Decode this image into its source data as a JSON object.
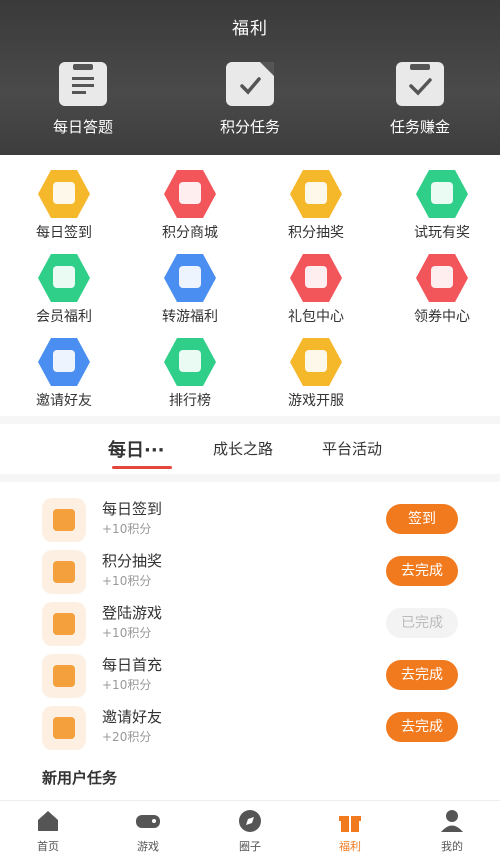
{
  "header": {
    "title": "福利",
    "features": [
      {
        "label": "每日答题",
        "icon": "quiz-clipboard-icon"
      },
      {
        "label": "积分任务",
        "icon": "points-task-icon"
      },
      {
        "label": "任务赚金",
        "icon": "earn-task-icon"
      }
    ]
  },
  "grid": [
    {
      "label": "每日签到",
      "icon": "calendar-check-icon",
      "color": "#f6b82b"
    },
    {
      "label": "积分商城",
      "icon": "shop-icon",
      "color": "#f2555a"
    },
    {
      "label": "积分抽奖",
      "icon": "coin-stack-icon",
      "color": "#f6b82b"
    },
    {
      "label": "试玩有奖",
      "icon": "trial-reward-icon",
      "color": "#2fcf8a"
    },
    {
      "label": "会员福利",
      "icon": "vip-badge-icon",
      "color": "#2fcf8a"
    },
    {
      "label": "转游福利",
      "icon": "transfer-game-icon",
      "color": "#4a8ef1"
    },
    {
      "label": "礼包中心",
      "icon": "gift-pack-icon",
      "color": "#f2555a"
    },
    {
      "label": "领券中心",
      "icon": "coupon-icon",
      "color": "#f2555a"
    },
    {
      "label": "邀请好友",
      "icon": "invite-mail-icon",
      "color": "#4a8ef1"
    },
    {
      "label": "排行榜",
      "icon": "trophy-icon",
      "color": "#2fcf8a"
    },
    {
      "label": "游戏开服",
      "icon": "server-open-icon",
      "color": "#f6b82b"
    }
  ],
  "tabs": [
    {
      "label": "每日···",
      "active": true
    },
    {
      "label": "成长之路",
      "active": false
    },
    {
      "label": "平台活动",
      "active": false
    }
  ],
  "tasks": [
    {
      "title": "每日签到",
      "points": "+10积分",
      "button": "签到",
      "done": false,
      "icon": "checkin-icon"
    },
    {
      "title": "积分抽奖",
      "points": "+10积分",
      "button": "去完成",
      "done": false,
      "icon": "lottery-wheel-icon"
    },
    {
      "title": "登陆游戏",
      "points": "+10积分",
      "button": "已完成",
      "done": true,
      "icon": "login-game-icon"
    },
    {
      "title": "每日首充",
      "points": "+10积分",
      "button": "去完成",
      "done": false,
      "icon": "recharge-icon"
    },
    {
      "title": "邀请好友",
      "points": "+20积分",
      "button": "去完成",
      "done": false,
      "icon": "invite-envelope-icon"
    }
  ],
  "new_user_section": "新用户任务",
  "bottom_nav": [
    {
      "label": "首页",
      "icon": "home-icon",
      "active": false
    },
    {
      "label": "游戏",
      "icon": "gamepad-icon",
      "active": false
    },
    {
      "label": "圈子",
      "icon": "compass-icon",
      "active": false
    },
    {
      "label": "福利",
      "icon": "gift-icon",
      "active": true
    },
    {
      "label": "我的",
      "icon": "user-icon",
      "active": false
    }
  ],
  "colors": {
    "accent": "#f27a1e",
    "tab_underline": "#e5463b",
    "header_bg": "#3d3d3d"
  }
}
